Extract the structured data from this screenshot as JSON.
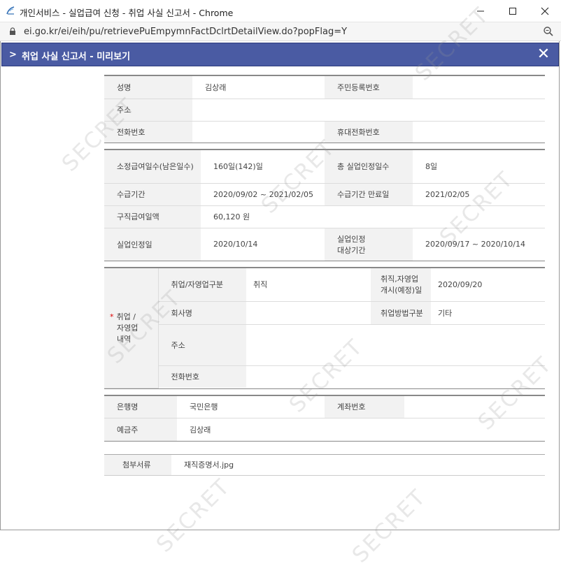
{
  "window": {
    "title": "개인서비스 - 실업급여 신청 - 취업 사실 신고서 - Chrome",
    "url": "ei.go.kr/ei/eih/pu/retrievePuEmpymnFactDclrtDetailView.do?popFlag=Y"
  },
  "popup": {
    "title": "취업 사실 신고서 - 미리보기"
  },
  "personal": {
    "name_label": "성명",
    "name_value": "김상래",
    "rrn_label": "주민등록번호",
    "rrn_value": "",
    "address_label": "주소",
    "address_value": "",
    "phone_label": "전화번호",
    "phone_value": "",
    "mobile_label": "휴대전화번호",
    "mobile_value": ""
  },
  "benefit": {
    "days_label": "소정급여일수(남은일수)",
    "days_value": "160일(142)일",
    "total_days_label": "총 실업인정일수",
    "total_days_value": "8일",
    "period_label": "수급기간",
    "period_value": "2020/09/02 ~ 2021/02/05",
    "period_end_label": "수급기간 만료일",
    "period_end_value": "2021/02/05",
    "daily_amount_label": "구직급여일액",
    "daily_amount_value": "60,120 원",
    "cert_date_label": "실업인정일",
    "cert_date_value": "2020/10/14",
    "cert_period_label_1": "실업인정",
    "cert_period_label_2": "대상기간",
    "cert_period_value": "2020/09/17 ~ 2020/10/14"
  },
  "employment": {
    "section_label_1": "취업 /",
    "section_label_2": "자영업",
    "section_label_3": "내역",
    "required_mark": "*",
    "type_label": "취업/자영업구분",
    "type_value": "취직",
    "start_label_1": "취직,자영업",
    "start_label_2": "개시(예정)일",
    "start_value": "2020/09/20",
    "company_label": "회사명",
    "company_value": "",
    "method_label": "취업방법구분",
    "method_value": "기타",
    "address_label": "주소",
    "address_value": "",
    "phone_label": "전화번호",
    "phone_value": ""
  },
  "bank": {
    "bank_label": "은행명",
    "bank_value": "국민은행",
    "account_label": "계좌번호",
    "account_value": "",
    "holder_label": "예금주",
    "holder_value": "김상래"
  },
  "attachment": {
    "label": "첨부서류",
    "value": "재직증명서.jpg"
  },
  "watermarks": [
    "SECRET",
    "SECRET",
    "SECRET",
    "SECRET",
    "SECRET",
    "SECRET",
    "SECRET",
    "SECRET",
    "SECRET"
  ]
}
